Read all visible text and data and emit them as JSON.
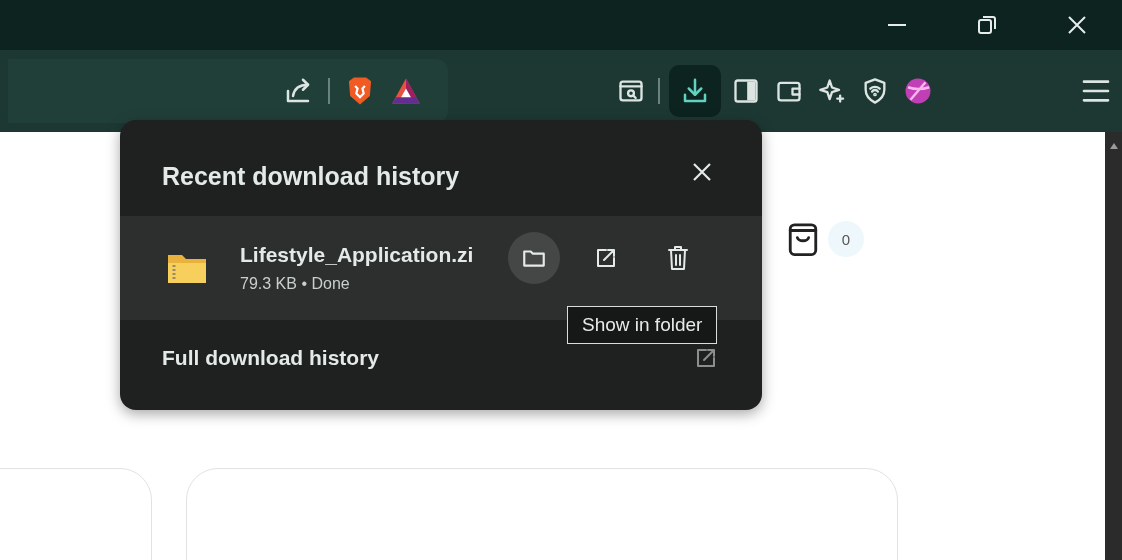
{
  "address_bar_buttons": [
    {
      "kind": "share"
    },
    {
      "kind": "shields"
    },
    {
      "kind": "rewards"
    }
  ],
  "toolbar_buttons": [
    {
      "kind": "reader",
      "selected": false
    },
    {
      "kind": "download",
      "selected": true
    },
    {
      "kind": "sidebar",
      "selected": false
    },
    {
      "kind": "wallet",
      "selected": false
    },
    {
      "kind": "leo",
      "selected": false
    },
    {
      "kind": "vpn",
      "selected": false
    },
    {
      "kind": "profile",
      "selected": false
    },
    {
      "kind": "menu",
      "selected": false
    }
  ],
  "download_popup": {
    "title": "Recent download history",
    "item": {
      "name": "Lifestyle_Application.zi",
      "status": "79.3 KB • Done",
      "actions": [
        {
          "kind": "folder",
          "hovered": true
        },
        {
          "kind": "open",
          "hovered": false
        },
        {
          "kind": "delete",
          "hovered": false
        }
      ]
    },
    "footer": "Full download history",
    "tooltip": "Show in folder"
  },
  "page": {
    "cart_count": "0"
  }
}
